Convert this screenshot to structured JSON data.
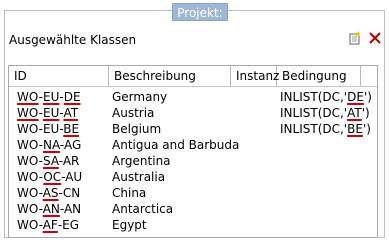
{
  "header": {
    "tab_label": "Projekt:"
  },
  "panel": {
    "title": "Ausgewählte Klassen",
    "icons": {
      "new": "new-document-icon",
      "close": "close-icon"
    },
    "colors": {
      "tab": "#9fb7d4",
      "close_icon": "#c00000",
      "spell_underline": "#d40000"
    }
  },
  "table": {
    "columns": [
      "ID",
      "Beschreibung",
      "Instanz",
      "Bedingung"
    ],
    "rows": [
      {
        "id": {
          "pre": "",
          "u1": "WO",
          "mid": "-",
          "u2": "EU",
          "mid2": "-",
          "u3": "DE",
          "post": ""
        },
        "desc": "Germany",
        "instanz": "",
        "bed": {
          "pre": "INLIST(DC,'",
          "u": "DE",
          "post": "')"
        }
      },
      {
        "id": {
          "pre": "",
          "u1": "WO",
          "mid": "-",
          "u2": "EU",
          "mid2": "-",
          "u3": "AT",
          "post": ""
        },
        "desc": "Austria",
        "instanz": "",
        "bed": {
          "pre": "INLIST(DC,'",
          "u": "AT",
          "post": "')"
        }
      },
      {
        "id": {
          "pre": "WO-EU-",
          "u1": "",
          "mid": "",
          "u2": "",
          "mid2": "",
          "u3": "BE",
          "post": ""
        },
        "desc": "Belgium",
        "instanz": "",
        "bed": {
          "pre": "INLIST(DC,'",
          "u": "BE",
          "post": "')"
        }
      },
      {
        "id": {
          "pre": "WO-",
          "u1": "",
          "mid": "",
          "u2": "NA",
          "mid2": "",
          "u3": "",
          "post": "-AG"
        },
        "desc": "Antigua and Barbuda",
        "instanz": "",
        "bed": {
          "pre": "",
          "u": "",
          "post": ""
        }
      },
      {
        "id": {
          "pre": "WO-",
          "u1": "",
          "mid": "",
          "u2": "SA",
          "mid2": "",
          "u3": "",
          "post": "-AR"
        },
        "desc": "Argentina",
        "instanz": "",
        "bed": {
          "pre": "",
          "u": "",
          "post": ""
        }
      },
      {
        "id": {
          "pre": "WO-",
          "u1": "",
          "mid": "",
          "u2": "OC",
          "mid2": "",
          "u3": "",
          "post": "-AU"
        },
        "desc": "Australia",
        "instanz": "",
        "bed": {
          "pre": "",
          "u": "",
          "post": ""
        }
      },
      {
        "id": {
          "pre": "WO-",
          "u1": "",
          "mid": "",
          "u2": "AS",
          "mid2": "",
          "u3": "",
          "post": "-CN"
        },
        "desc": "China",
        "instanz": "",
        "bed": {
          "pre": "",
          "u": "",
          "post": ""
        }
      },
      {
        "id": {
          "pre": "WO-",
          "u1": "",
          "mid": "",
          "u2": "AN",
          "mid2": "",
          "u3": "",
          "post": "-AN"
        },
        "desc": "Antarctica",
        "instanz": "",
        "bed": {
          "pre": "",
          "u": "",
          "post": ""
        }
      },
      {
        "id": {
          "pre": "WO-",
          "u1": "",
          "mid": "",
          "u2": "AF",
          "mid2": "",
          "u3": "",
          "post": "-EG"
        },
        "desc": "Egypt",
        "instanz": "",
        "bed": {
          "pre": "",
          "u": "",
          "post": ""
        }
      }
    ]
  }
}
